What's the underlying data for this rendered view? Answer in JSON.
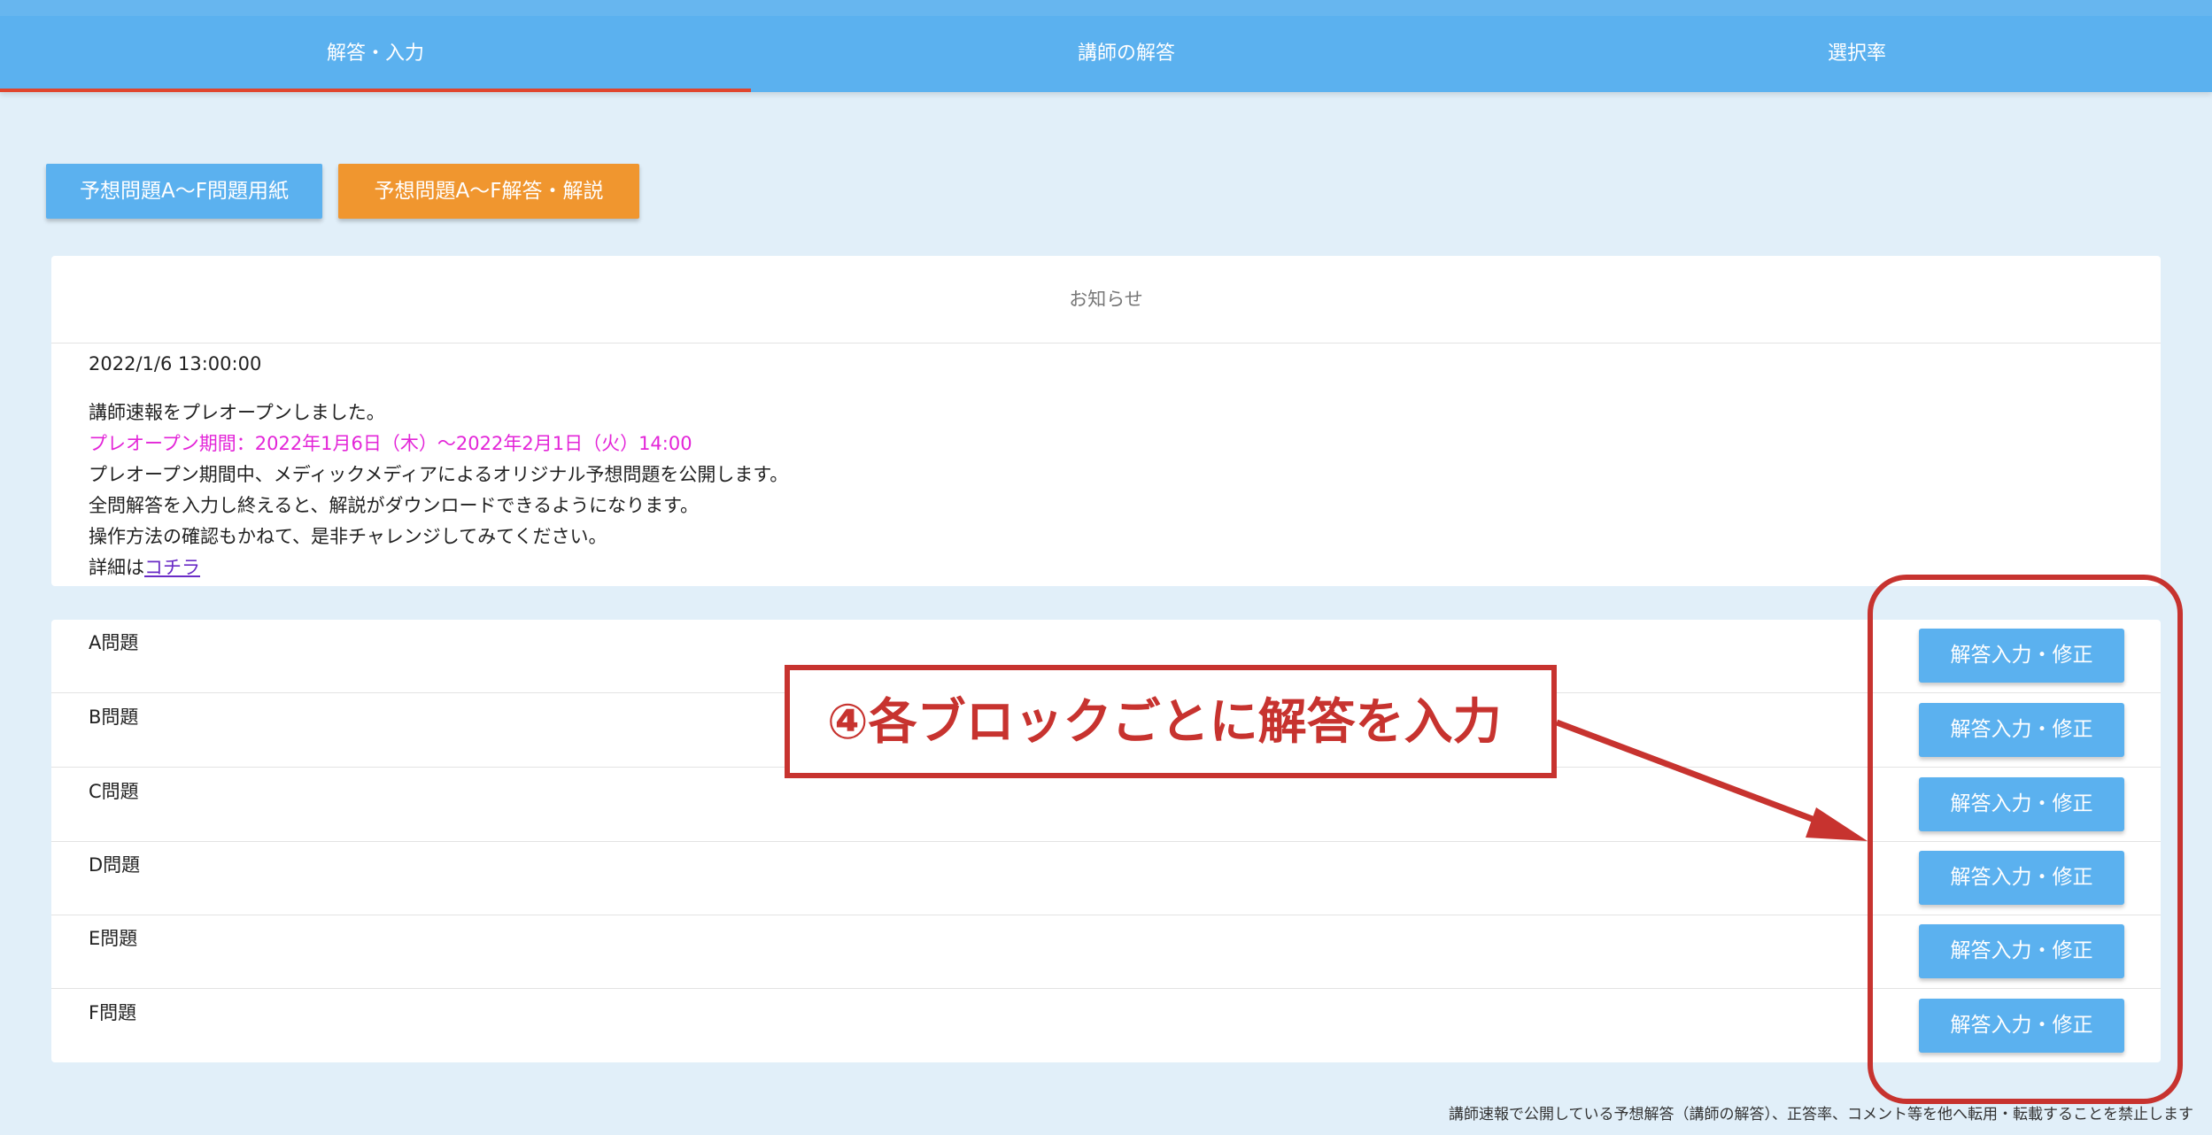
{
  "tabs": [
    {
      "label": "解答・入力",
      "active": true
    },
    {
      "label": "講師の解答",
      "active": false
    },
    {
      "label": "選択率",
      "active": false
    }
  ],
  "top_buttons": {
    "questions": "予想問題A〜F問題用紙",
    "answers": "予想問題A〜F解答・解説"
  },
  "notice": {
    "title": "お知らせ",
    "date": "2022/1/6 13:00:00",
    "line1": "講師速報をプレオープンしました。",
    "line2": "プレオープン期間：2022年1月6日（木）〜2022年2月1日（火）14:00",
    "line3": "プレオープン期間中、メディックメディアによるオリジナル予想問題を公開します。",
    "line4": "全問解答を入力し終えると、解説がダウンロードできるようになります。",
    "line5": "操作方法の確認もかねて、是非チャレンジしてみてください。",
    "line6_prefix": "詳細は",
    "line6_link": "コチラ"
  },
  "problems": [
    {
      "label": "A問題",
      "button": "解答入力・修正"
    },
    {
      "label": "B問題",
      "button": "解答入力・修正"
    },
    {
      "label": "C問題",
      "button": "解答入力・修正"
    },
    {
      "label": "D問題",
      "button": "解答入力・修正"
    },
    {
      "label": "E問題",
      "button": "解答入力・修正"
    },
    {
      "label": "F問題",
      "button": "解答入力・修正"
    }
  ],
  "annotation": {
    "text": "④各ブロックごとに解答を入力",
    "color": "#c7332f"
  },
  "footer": {
    "text": "講師速報で公開している予想解答（講師の解答）、正答率、コメント等を他へ転用・転載することを禁止します"
  },
  "colors": {
    "tab_bar": "#5bb1ef",
    "active_tab_underline": "#e0452d",
    "button_blue": "#5bb1ef",
    "button_orange": "#f0962f",
    "highlight_text": "#e325d8",
    "page_background": "#e1eff9"
  }
}
